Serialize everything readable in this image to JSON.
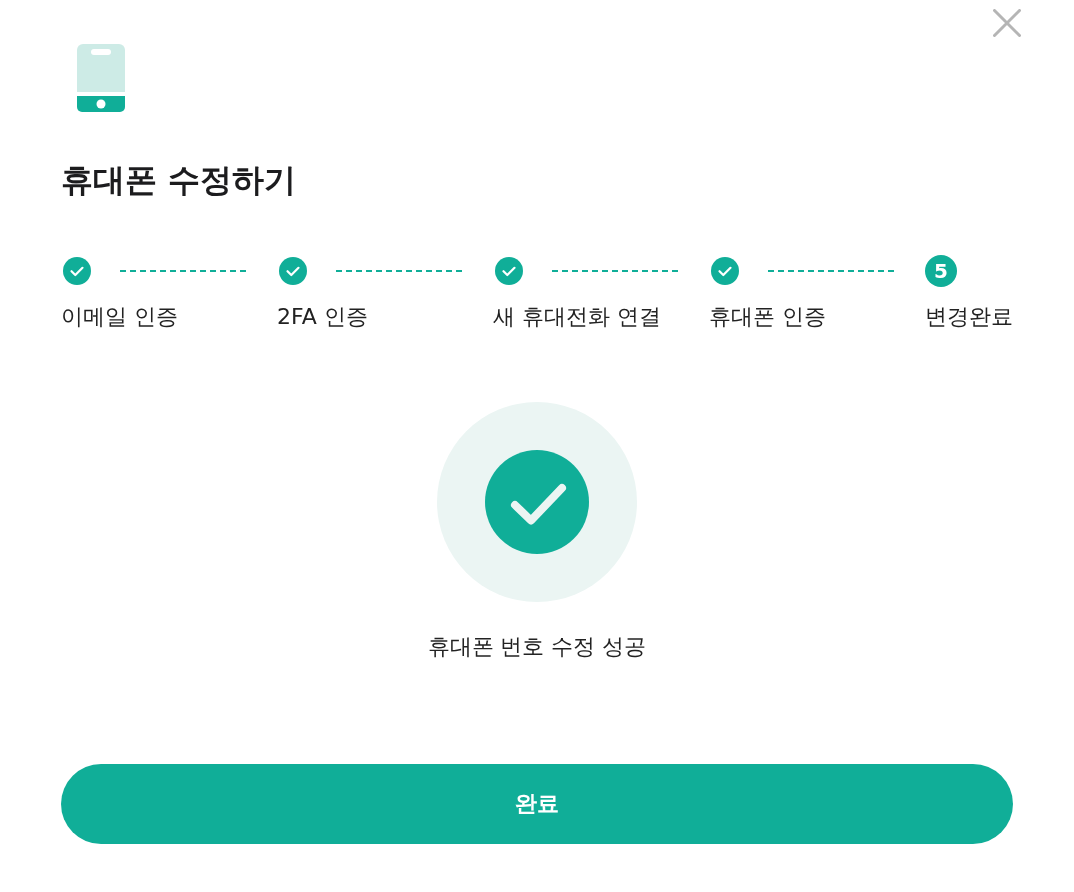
{
  "title": "휴대폰 수정하기",
  "steps": [
    {
      "label": "이메일 인증",
      "completed": true
    },
    {
      "label": "2FA 인증",
      "completed": true
    },
    {
      "label": "새 휴대전화 연결",
      "completed": true
    },
    {
      "label": "휴대폰 인증",
      "completed": true
    },
    {
      "label": "변경완료",
      "number": "5",
      "completed": false
    }
  ],
  "result": {
    "message": "휴대폰 번호 수정 성공"
  },
  "button": {
    "label": "완료"
  }
}
